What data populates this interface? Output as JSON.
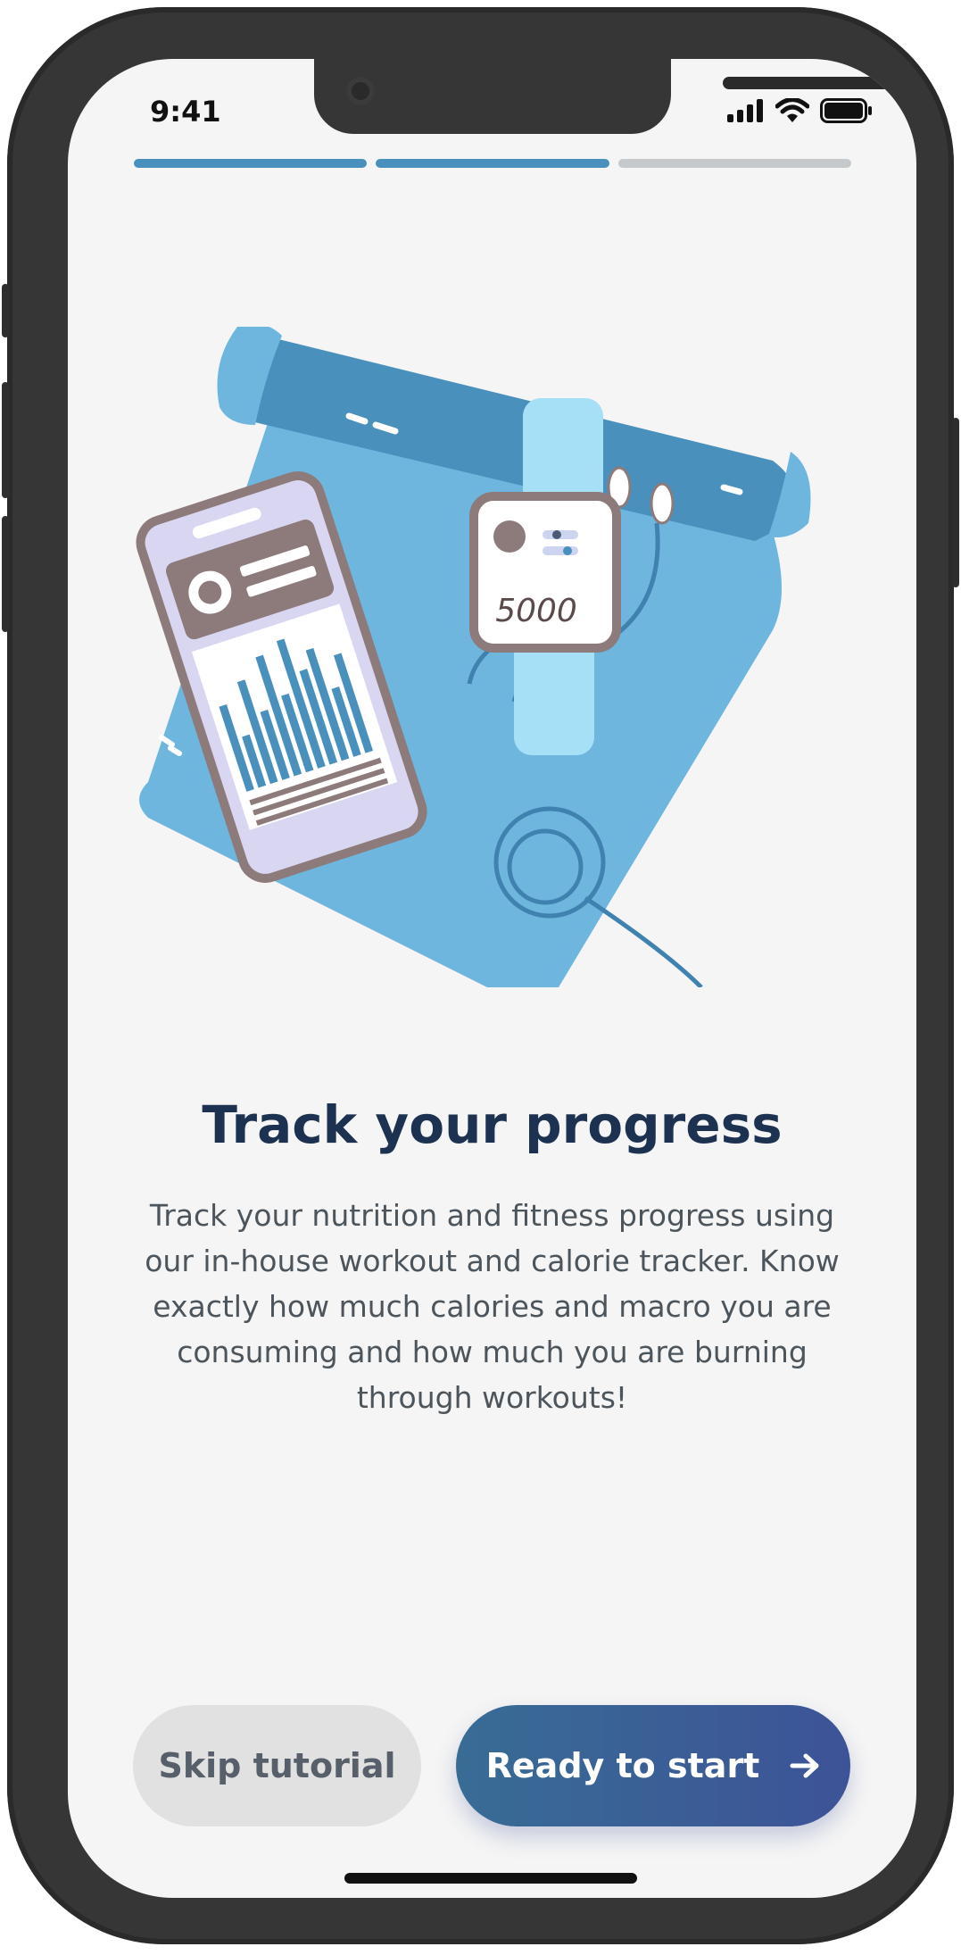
{
  "status_bar": {
    "time": "9:41"
  },
  "onboarding": {
    "steps_total": 3,
    "steps_completed": 2,
    "title": "Track your progress",
    "description": "Track your nutrition and fitness progress using our in-house workout and calorie tracker. Know exactly how much calories and macro you are consuming and how much you are burning through workouts!",
    "watch_step_count": "5000"
  },
  "actions": {
    "skip_label": "Skip tutorial",
    "start_label": "Ready to start"
  },
  "colors": {
    "accent_blue": "#4a90bd",
    "title_navy": "#1c3250",
    "button_gradient_start": "#386c95",
    "button_gradient_end": "#3d5397"
  }
}
